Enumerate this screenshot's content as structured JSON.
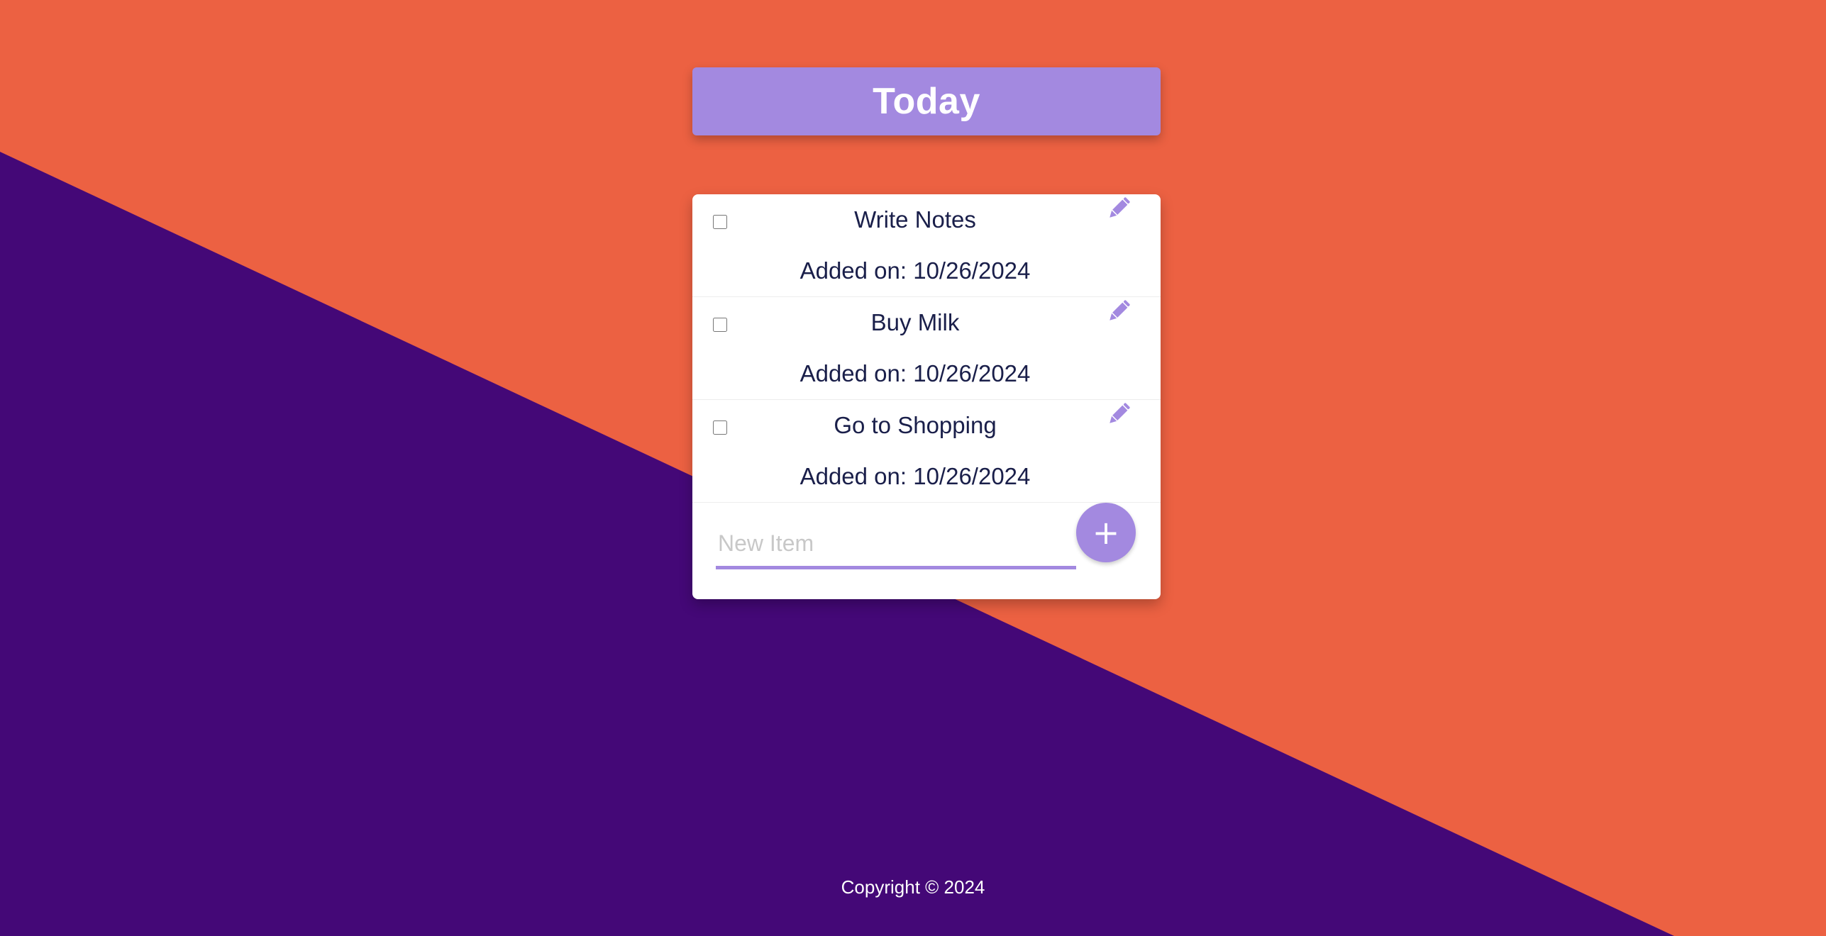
{
  "header": {
    "title": "Today"
  },
  "items": [
    {
      "title": "Write Notes",
      "date": "Added on: 10/26/2024",
      "checked": false
    },
    {
      "title": "Buy Milk",
      "date": "Added on: 10/26/2024",
      "checked": false
    },
    {
      "title": "Go to Shopping",
      "date": "Added on: 10/26/2024",
      "checked": false
    }
  ],
  "new_item": {
    "placeholder": "New Item",
    "value": "",
    "add_label": "+"
  },
  "footer": {
    "copyright": "Copyright © 2024"
  },
  "icons": {
    "edit": "pencil-icon",
    "add": "plus-icon"
  },
  "colors": {
    "background_orange": "#EC6142",
    "background_purple": "#440877",
    "accent": "#A389E0",
    "text": "#1A1F4A",
    "card": "#FFFFFF"
  }
}
